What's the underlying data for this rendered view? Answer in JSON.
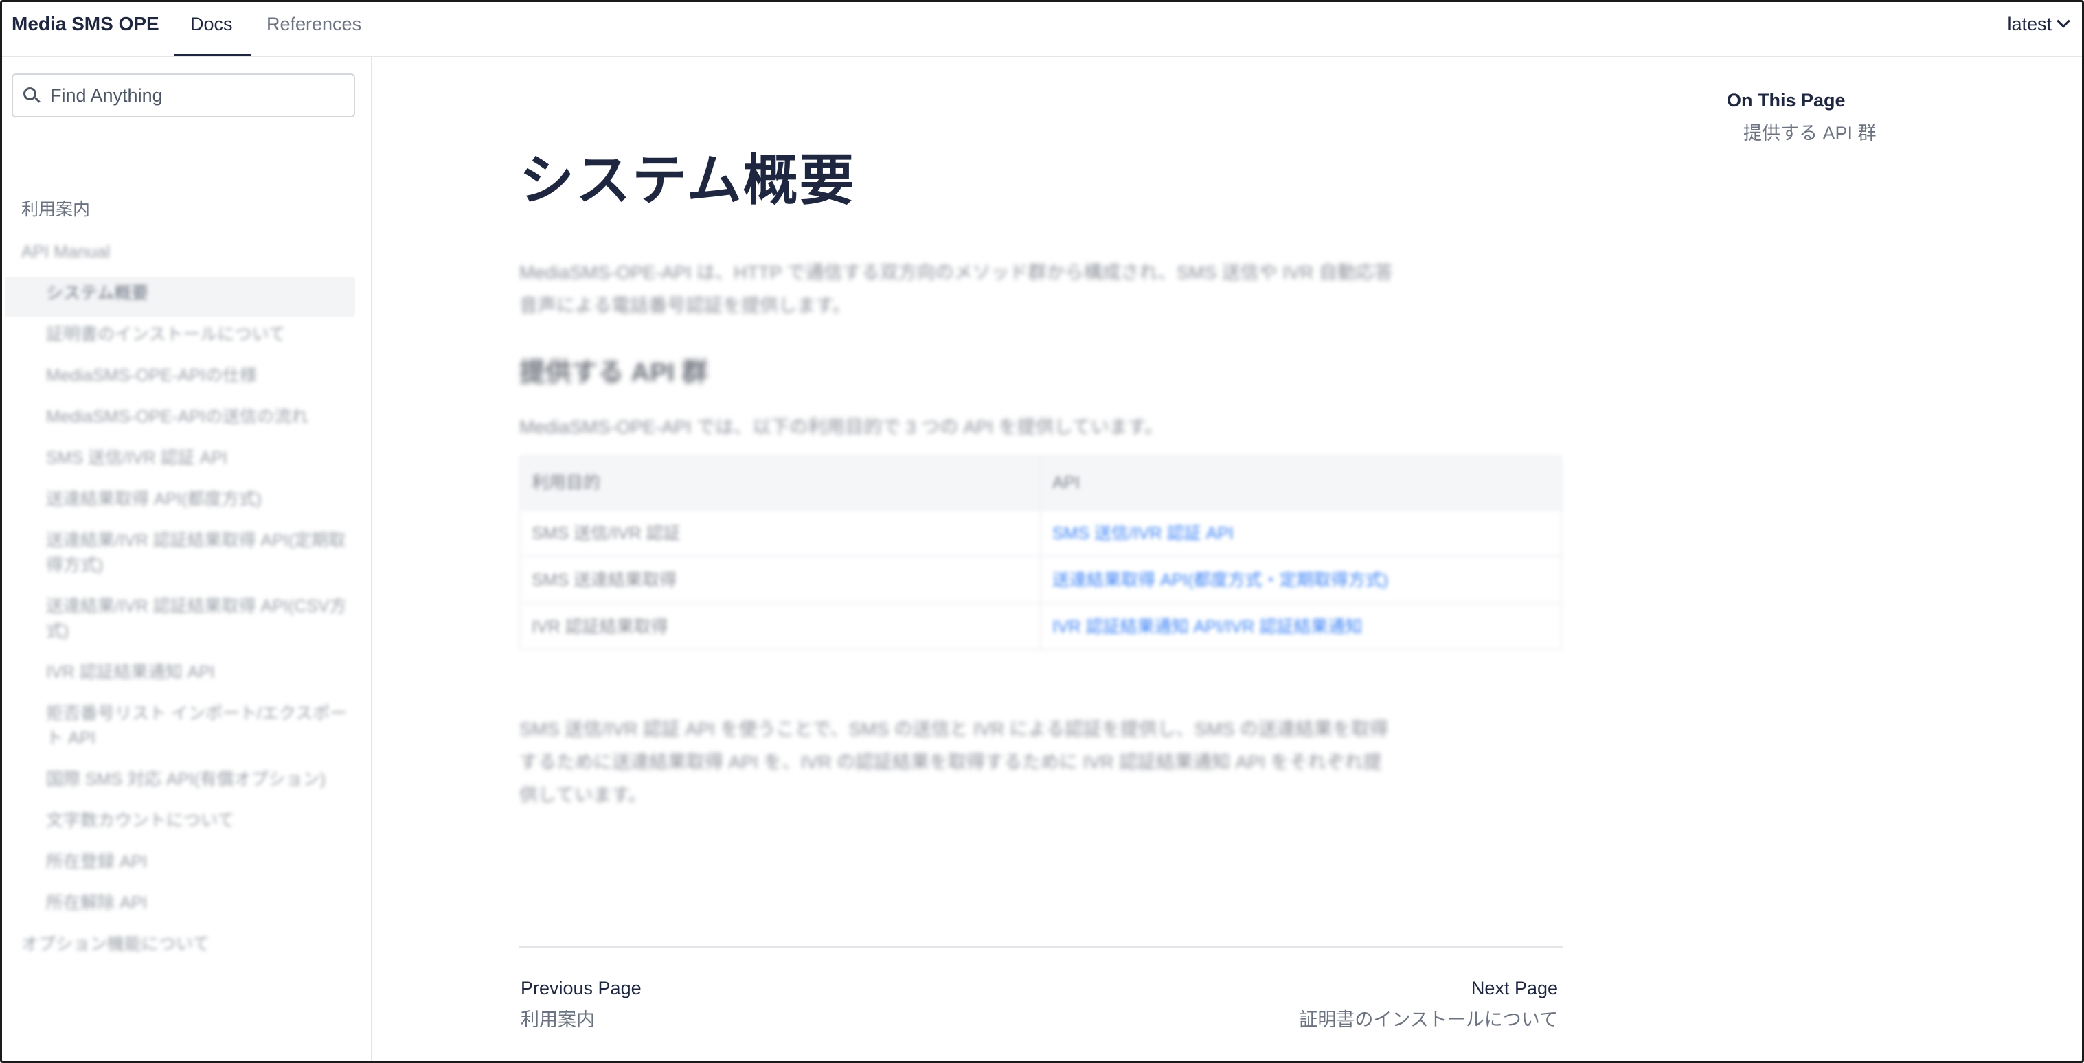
{
  "header": {
    "brand": "Media SMS OPE",
    "tabs": [
      {
        "label": "Docs",
        "active": true
      },
      {
        "label": "References",
        "active": false
      }
    ],
    "version": "latest"
  },
  "sidebar": {
    "search_placeholder": "Find Anything",
    "items": [
      {
        "label": "利用案内",
        "level": 0
      },
      {
        "label": "API Manual",
        "level": 0
      },
      {
        "label": "システム概要",
        "level": 1,
        "selected": true
      },
      {
        "label": "証明書のインストールについて",
        "level": 1
      },
      {
        "label": "MediaSMS-OPE-APIの仕様",
        "level": 1
      },
      {
        "label": "MediaSMS-OPE-APIの送信の流れ",
        "level": 1
      },
      {
        "label": "SMS 送信/IVR 認証 API",
        "level": 1
      },
      {
        "label": "送達結果取得 API(都度方式)",
        "level": 1
      },
      {
        "label": "送達結果/IVR 認証結果取得 API(定期取得方式)",
        "level": 1
      },
      {
        "label": "送達結果/IVR 認証結果取得 API(CSV方式)",
        "level": 1
      },
      {
        "label": "IVR 認証結果通知 API",
        "level": 1
      },
      {
        "label": "拒否番号リスト インポート/エクスポート API",
        "level": 1
      },
      {
        "label": "国際 SMS 対応 API(有償オプション)",
        "level": 1
      },
      {
        "label": "文字数カウントについて",
        "level": 1
      },
      {
        "label": "所在登録 API",
        "level": 1
      },
      {
        "label": "所在解除 API",
        "level": 1
      },
      {
        "label": "オプション機能について",
        "level": 0
      }
    ]
  },
  "main": {
    "title": "システム概要",
    "intro": "MediaSMS-OPE-API は、HTTP で通信する双方向のメソッド群から構成され、SMS 送信や IVR 自動応答音声による電話番号認証を提供します。",
    "section_title": "提供する API 群",
    "section_intro": "MediaSMS-OPE-API では、以下の利用目的で 3 つの API を提供しています。",
    "table": {
      "headers": [
        "利用目的",
        "API"
      ],
      "rows": [
        [
          "SMS 送信/IVR 認証",
          "SMS 送信/IVR 認証 API"
        ],
        [
          "SMS 送達結果取得",
          "送達結果取得 API(都度方式・定期取得方式)"
        ],
        [
          "IVR 認証結果取得",
          "IVR 認証結果通知 API/IVR 認証結果通知"
        ]
      ]
    },
    "closing": "SMS 送信/IVR 認証 API を使うことで、SMS の送信と IVR による認証を提供し、SMS の送達結果を取得するために送達結果取得 API を、IVR の認証結果を取得するために IVR 認証結果通知 API をそれぞれ提供しています。",
    "pager": {
      "prev_label": "Previous Page",
      "prev_title": "利用案内",
      "next_label": "Next Page",
      "next_title": "証明書のインストールについて"
    }
  },
  "toc": {
    "title": "On This Page",
    "items": [
      "提供する API 群"
    ]
  },
  "colors": {
    "text_dark": "#1f2740",
    "text_muted": "#6b7280",
    "link": "#3b82f6",
    "border": "#e3e5e8",
    "selected_bg": "#f3f4f6"
  }
}
